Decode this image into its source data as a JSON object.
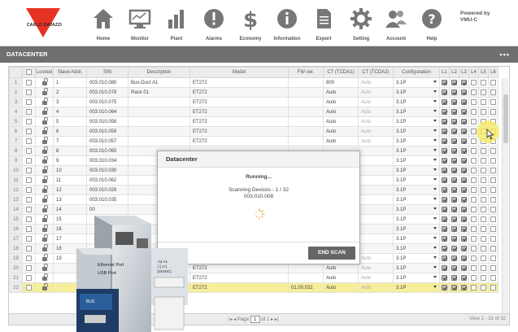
{
  "header": {
    "logo_text": "CARLO GAVAZZI",
    "powered_line1": "Powered by",
    "powered_line2": "VMU-C",
    "nav": [
      {
        "label": "Home",
        "icon": "home-icon"
      },
      {
        "label": "Monitor",
        "icon": "monitor-icon"
      },
      {
        "label": "Plant",
        "icon": "bar-chart-icon"
      },
      {
        "label": "Alarms",
        "icon": "warning-icon"
      },
      {
        "label": "Economy",
        "icon": "dollar-icon"
      },
      {
        "label": "Information",
        "icon": "info-icon"
      },
      {
        "label": "Export",
        "icon": "document-icon"
      },
      {
        "label": "Setting",
        "icon": "gear-icon"
      },
      {
        "label": "Account",
        "icon": "users-icon"
      },
      {
        "label": "Help",
        "icon": "help-icon"
      }
    ]
  },
  "section": {
    "title": "DATACENTER",
    "menu": "•••"
  },
  "table": {
    "columns": [
      "",
      "",
      "Locked",
      "Slave Addr.",
      "SIN",
      "Description",
      "Model",
      "FW ver.",
      "CT (TCDA1)",
      "CT (TCDA2)",
      "Configuration",
      "L1",
      "L2",
      "L3",
      "L4",
      "L5",
      "L6"
    ],
    "rows": [
      {
        "n": "1",
        "addr": "1",
        "sin": "003.010.080",
        "desc": "Bus-Duct A1",
        "model": "ET272",
        "fw": "",
        "ct1": "800",
        "ct2": "Auto",
        "conf": "3.1P"
      },
      {
        "n": "2",
        "addr": "2",
        "sin": "003.010.078",
        "desc": "Rack 01",
        "model": "ET272",
        "fw": "",
        "ct1": "Auto",
        "ct2": "Auto",
        "conf": "3.1P"
      },
      {
        "n": "3",
        "addr": "3",
        "sin": "003.010.075",
        "desc": "",
        "model": "ET272",
        "fw": "",
        "ct1": "Auto",
        "ct2": "Auto",
        "conf": "3.1P"
      },
      {
        "n": "4",
        "addr": "4",
        "sin": "003.010.064",
        "desc": "",
        "model": "ET272",
        "fw": "",
        "ct1": "Auto",
        "ct2": "Auto",
        "conf": "3.1P"
      },
      {
        "n": "5",
        "addr": "5",
        "sin": "003.010.058",
        "desc": "",
        "model": "ET272",
        "fw": "",
        "ct1": "Auto",
        "ct2": "Auto",
        "conf": "3.1P"
      },
      {
        "n": "6",
        "addr": "6",
        "sin": "003.010.059",
        "desc": "",
        "model": "ET272",
        "fw": "",
        "ct1": "Auto",
        "ct2": "Auto",
        "conf": "3.1P"
      },
      {
        "n": "7",
        "addr": "7",
        "sin": "003.010.057",
        "desc": "",
        "model": "ET272",
        "fw": "",
        "ct1": "Auto",
        "ct2": "Auto",
        "conf": "3.1P"
      },
      {
        "n": "8",
        "addr": "8",
        "sin": "003.010.065",
        "desc": "",
        "model": "",
        "fw": "",
        "ct1": "",
        "ct2": "",
        "conf": "3.1P"
      },
      {
        "n": "9",
        "addr": "9",
        "sin": "003.010.034",
        "desc": "",
        "model": "",
        "fw": "",
        "ct1": "",
        "ct2": "",
        "conf": "3.1P"
      },
      {
        "n": "10",
        "addr": "10",
        "sin": "003.010.030",
        "desc": "",
        "model": "",
        "fw": "",
        "ct1": "",
        "ct2": "",
        "conf": "3.1P"
      },
      {
        "n": "11",
        "addr": "11",
        "sin": "003.010.062",
        "desc": "",
        "model": "",
        "fw": "",
        "ct1": "",
        "ct2": "",
        "conf": "3.1P"
      },
      {
        "n": "12",
        "addr": "12",
        "sin": "003.010.026",
        "desc": "",
        "model": "",
        "fw": "",
        "ct1": "",
        "ct2": "",
        "conf": "3.1P"
      },
      {
        "n": "13",
        "addr": "13",
        "sin": "003.010.035",
        "desc": "",
        "model": "",
        "fw": "",
        "ct1": "",
        "ct2": "",
        "conf": "3.1P"
      },
      {
        "n": "14",
        "addr": "14",
        "sin": "00",
        "desc": "",
        "model": "",
        "fw": "",
        "ct1": "",
        "ct2": "",
        "conf": "3.1P"
      },
      {
        "n": "15",
        "addr": "15",
        "sin": "",
        "desc": "",
        "model": "",
        "fw": "",
        "ct1": "",
        "ct2": "",
        "conf": "3.1P"
      },
      {
        "n": "16",
        "addr": "16",
        "sin": "",
        "desc": "",
        "model": "",
        "fw": "",
        "ct1": "",
        "ct2": "",
        "conf": "3.1P"
      },
      {
        "n": "17",
        "addr": "17",
        "sin": "",
        "desc": "",
        "model": "",
        "fw": "",
        "ct1": "",
        "ct2": "",
        "conf": "3.1P"
      },
      {
        "n": "18",
        "addr": "18",
        "sin": "",
        "desc": "",
        "model": "",
        "fw": "",
        "ct1": "",
        "ct2": "",
        "conf": "3.1P"
      },
      {
        "n": "19",
        "addr": "19",
        "sin": "",
        "desc": "",
        "model": "ET272",
        "fw": "",
        "ct1": "Auto",
        "ct2": "Auto",
        "conf": "3.1P"
      },
      {
        "n": "20",
        "addr": "",
        "sin": "",
        "desc": "",
        "model": "ET272",
        "fw": "",
        "ct1": "Auto",
        "ct2": "Auto",
        "conf": "3.1P"
      },
      {
        "n": "21",
        "addr": "",
        "sin": "",
        "desc": "",
        "model": "ET272",
        "fw": "",
        "ct1": "Auto",
        "ct2": "Auto",
        "conf": "3.1P"
      },
      {
        "n": "22",
        "addr": "",
        "sin": "",
        "desc": "0.008_22",
        "model": "ET272",
        "fw": "01.00.032",
        "ct1": "Auto",
        "ct2": "Auto",
        "conf": "3.1P"
      }
    ]
  },
  "modal": {
    "title": "Datacenter",
    "status": "Running...",
    "scanning": "Scanning Devices - 1 / 32",
    "serial": "003.010.008",
    "button": "END SCAN"
  },
  "footer": {
    "page_label": "Page",
    "page_value": "1",
    "of_label": "of 1",
    "view_info": "View 1 - 32 of 32"
  },
  "device": {
    "ethernet_label": "Ethernet Port",
    "usb_label": "USB Port",
    "terminal_label": "A2  A1\n(-)  (+)\n(24VDC)",
    "bus_label": "BUS",
    "brand": "CARLO GAVAZZI"
  },
  "colors": {
    "accent": "#e53323",
    "highlight": "#f7ee9c",
    "header_bar": "#6f6f6f"
  }
}
